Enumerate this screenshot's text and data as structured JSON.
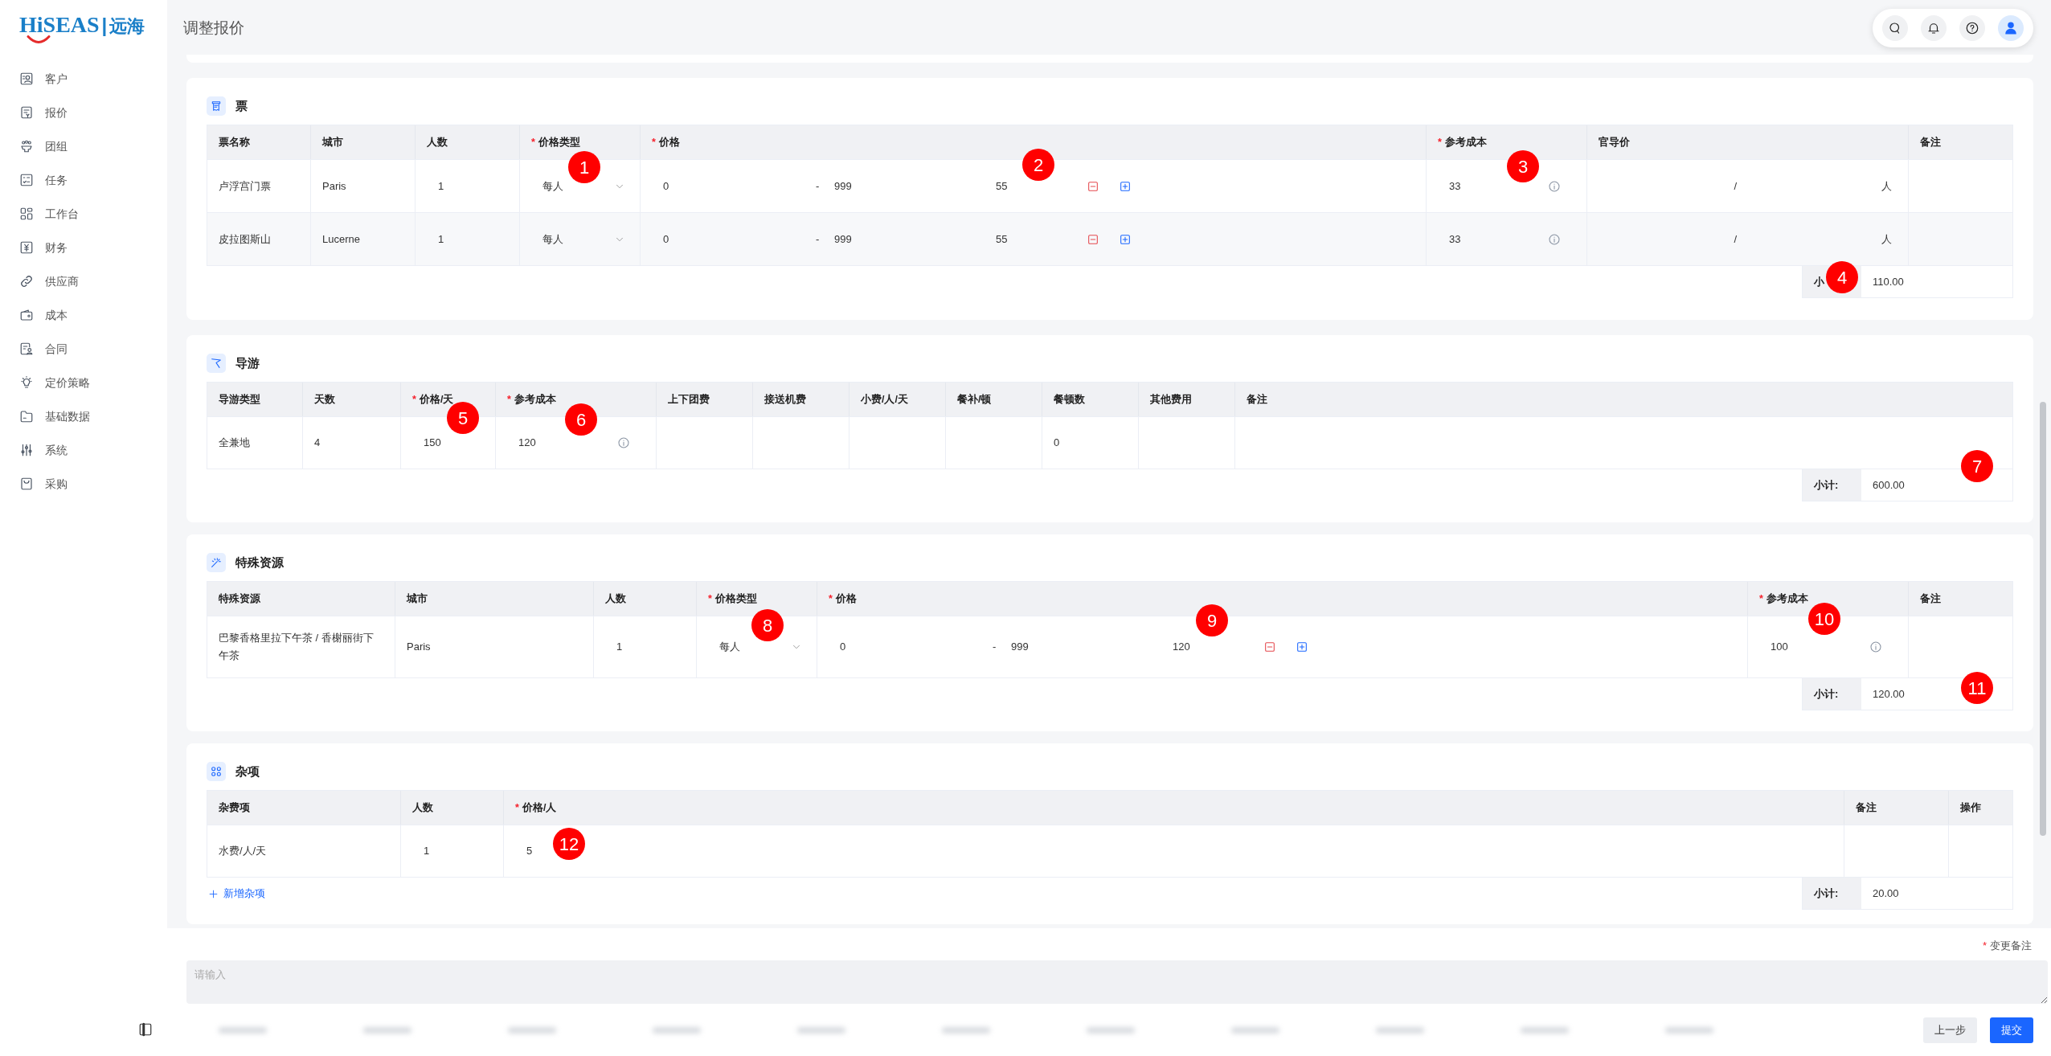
{
  "sidebar": {
    "logo": {
      "brand": "HiSEAS",
      "divider": "|",
      "sub": "远海"
    },
    "items": [
      {
        "label": "客户"
      },
      {
        "label": "报价"
      },
      {
        "label": "团组"
      },
      {
        "label": "任务"
      },
      {
        "label": "工作台"
      },
      {
        "label": "财务"
      },
      {
        "label": "供应商"
      },
      {
        "label": "成本"
      },
      {
        "label": "合同"
      },
      {
        "label": "定价策略"
      },
      {
        "label": "基础数据"
      },
      {
        "label": "系统"
      },
      {
        "label": "采购"
      }
    ]
  },
  "header": {
    "title": "调整报价"
  },
  "sections": [
    {
      "kind": "ticket",
      "title": "票",
      "columns": [
        {
          "label": "票名称"
        },
        {
          "label": "城市"
        },
        {
          "label": "人数"
        },
        {
          "label": "价格类型",
          "required_mark": "*"
        },
        {
          "label": "价格",
          "required_mark": "*"
        },
        {
          "label": "参考成本",
          "required_mark": "*"
        },
        {
          "label": "官导价"
        },
        {
          "label": "备注"
        }
      ],
      "rows": [
        [
          {
            "kind": "text",
            "text": "卢浮宫门票"
          },
          {
            "kind": "text",
            "text": "Paris"
          },
          {
            "kind": "num",
            "text": "1"
          },
          {
            "kind": "select",
            "text": "每人"
          },
          {
            "kind": "range",
            "from": "0",
            "sep": "-",
            "to": "999",
            "price": "55"
          },
          {
            "kind": "cost",
            "text": "33"
          },
          {
            "kind": "guide",
            "sep": "/",
            "unit": "人"
          },
          {
            "kind": "blank"
          }
        ],
        [
          {
            "kind": "text",
            "text": "皮拉图斯山"
          },
          {
            "kind": "text",
            "text": "Lucerne"
          },
          {
            "kind": "num",
            "text": "1"
          },
          {
            "kind": "select",
            "text": "每人"
          },
          {
            "kind": "range",
            "from": "0",
            "sep": "-",
            "to": "999",
            "price": "55"
          },
          {
            "kind": "cost",
            "text": "33"
          },
          {
            "kind": "guide",
            "sep": "/",
            "unit": "人"
          },
          {
            "kind": "blank"
          }
        ]
      ],
      "subtotal": {
        "label": "小",
        "value": "110.00"
      }
    },
    {
      "kind": "guide",
      "title": "导游",
      "columns": [
        {
          "label": "导游类型"
        },
        {
          "label": "天数"
        },
        {
          "label": "价格/天",
          "required_mark": "*"
        },
        {
          "label": "参考成本",
          "required_mark": "*"
        },
        {
          "label": "上下团费"
        },
        {
          "label": "接送机费"
        },
        {
          "label": "小费/人/天"
        },
        {
          "label": "餐补/顿"
        },
        {
          "label": "餐顿数"
        },
        {
          "label": "其他费用"
        },
        {
          "label": "备注"
        }
      ],
      "rows": [
        [
          {
            "kind": "text",
            "text": "全兼地"
          },
          {
            "kind": "text",
            "text": "4"
          },
          {
            "kind": "num",
            "text": "150"
          },
          {
            "kind": "cost",
            "text": "120"
          },
          {
            "kind": "blank"
          },
          {
            "kind": "blank"
          },
          {
            "kind": "blank"
          },
          {
            "kind": "blank"
          },
          {
            "kind": "text",
            "text": "0"
          },
          {
            "kind": "blank"
          },
          {
            "kind": "blank"
          }
        ]
      ],
      "subtotal": {
        "label": "小计:",
        "value": "600.00"
      }
    },
    {
      "kind": "special",
      "title": "特殊资源",
      "columns": [
        {
          "label": "特殊资源"
        },
        {
          "label": "城市"
        },
        {
          "label": "人数"
        },
        {
          "label": "价格类型",
          "required_mark": "*"
        },
        {
          "label": "价格",
          "required_mark": "*"
        },
        {
          "label": "参考成本",
          "required_mark": "*"
        },
        {
          "label": "备注"
        }
      ],
      "rows": [
        [
          {
            "kind": "text",
            "text": "巴黎香格里拉下午茶 / 香榭丽街下午茶"
          },
          {
            "kind": "text",
            "text": "Paris"
          },
          {
            "kind": "num",
            "text": "1"
          },
          {
            "kind": "select",
            "text": "每人"
          },
          {
            "kind": "range",
            "from": "0",
            "sep": "-",
            "to": "999",
            "price": "120"
          },
          {
            "kind": "cost",
            "text": "100"
          },
          {
            "kind": "blank"
          }
        ]
      ],
      "subtotal": {
        "label": "小计:",
        "value": "120.00"
      }
    },
    {
      "kind": "misc",
      "title": "杂项",
      "columns": [
        {
          "label": "杂费项"
        },
        {
          "label": "人数"
        },
        {
          "label": "价格/人",
          "required_mark": "*"
        },
        {
          "label": "备注"
        },
        {
          "label": "操作"
        }
      ],
      "rows": [
        [
          {
            "kind": "text",
            "text": "水费/人/天"
          },
          {
            "kind": "num",
            "text": "1"
          },
          {
            "kind": "num",
            "text": "5"
          },
          {
            "kind": "blank"
          },
          {
            "kind": "blank"
          }
        ]
      ],
      "add_link": "新增杂项",
      "subtotal": {
        "label": "小计:",
        "value": "20.00"
      }
    }
  ],
  "footer": {
    "required_mark": "*",
    "remark_label": "变更备注",
    "placeholder": "请输入",
    "buttons": [
      {
        "label": "上一步",
        "kind": "secondary"
      },
      {
        "label": "提交",
        "kind": "primary"
      }
    ]
  },
  "markers": [
    {
      "number": "1"
    },
    {
      "number": "2"
    },
    {
      "number": "3"
    },
    {
      "number": "4"
    },
    {
      "number": "5"
    },
    {
      "number": "6"
    },
    {
      "number": "7"
    },
    {
      "number": "8"
    },
    {
      "number": "9"
    },
    {
      "number": "10"
    },
    {
      "number": "11"
    },
    {
      "number": "12"
    }
  ]
}
